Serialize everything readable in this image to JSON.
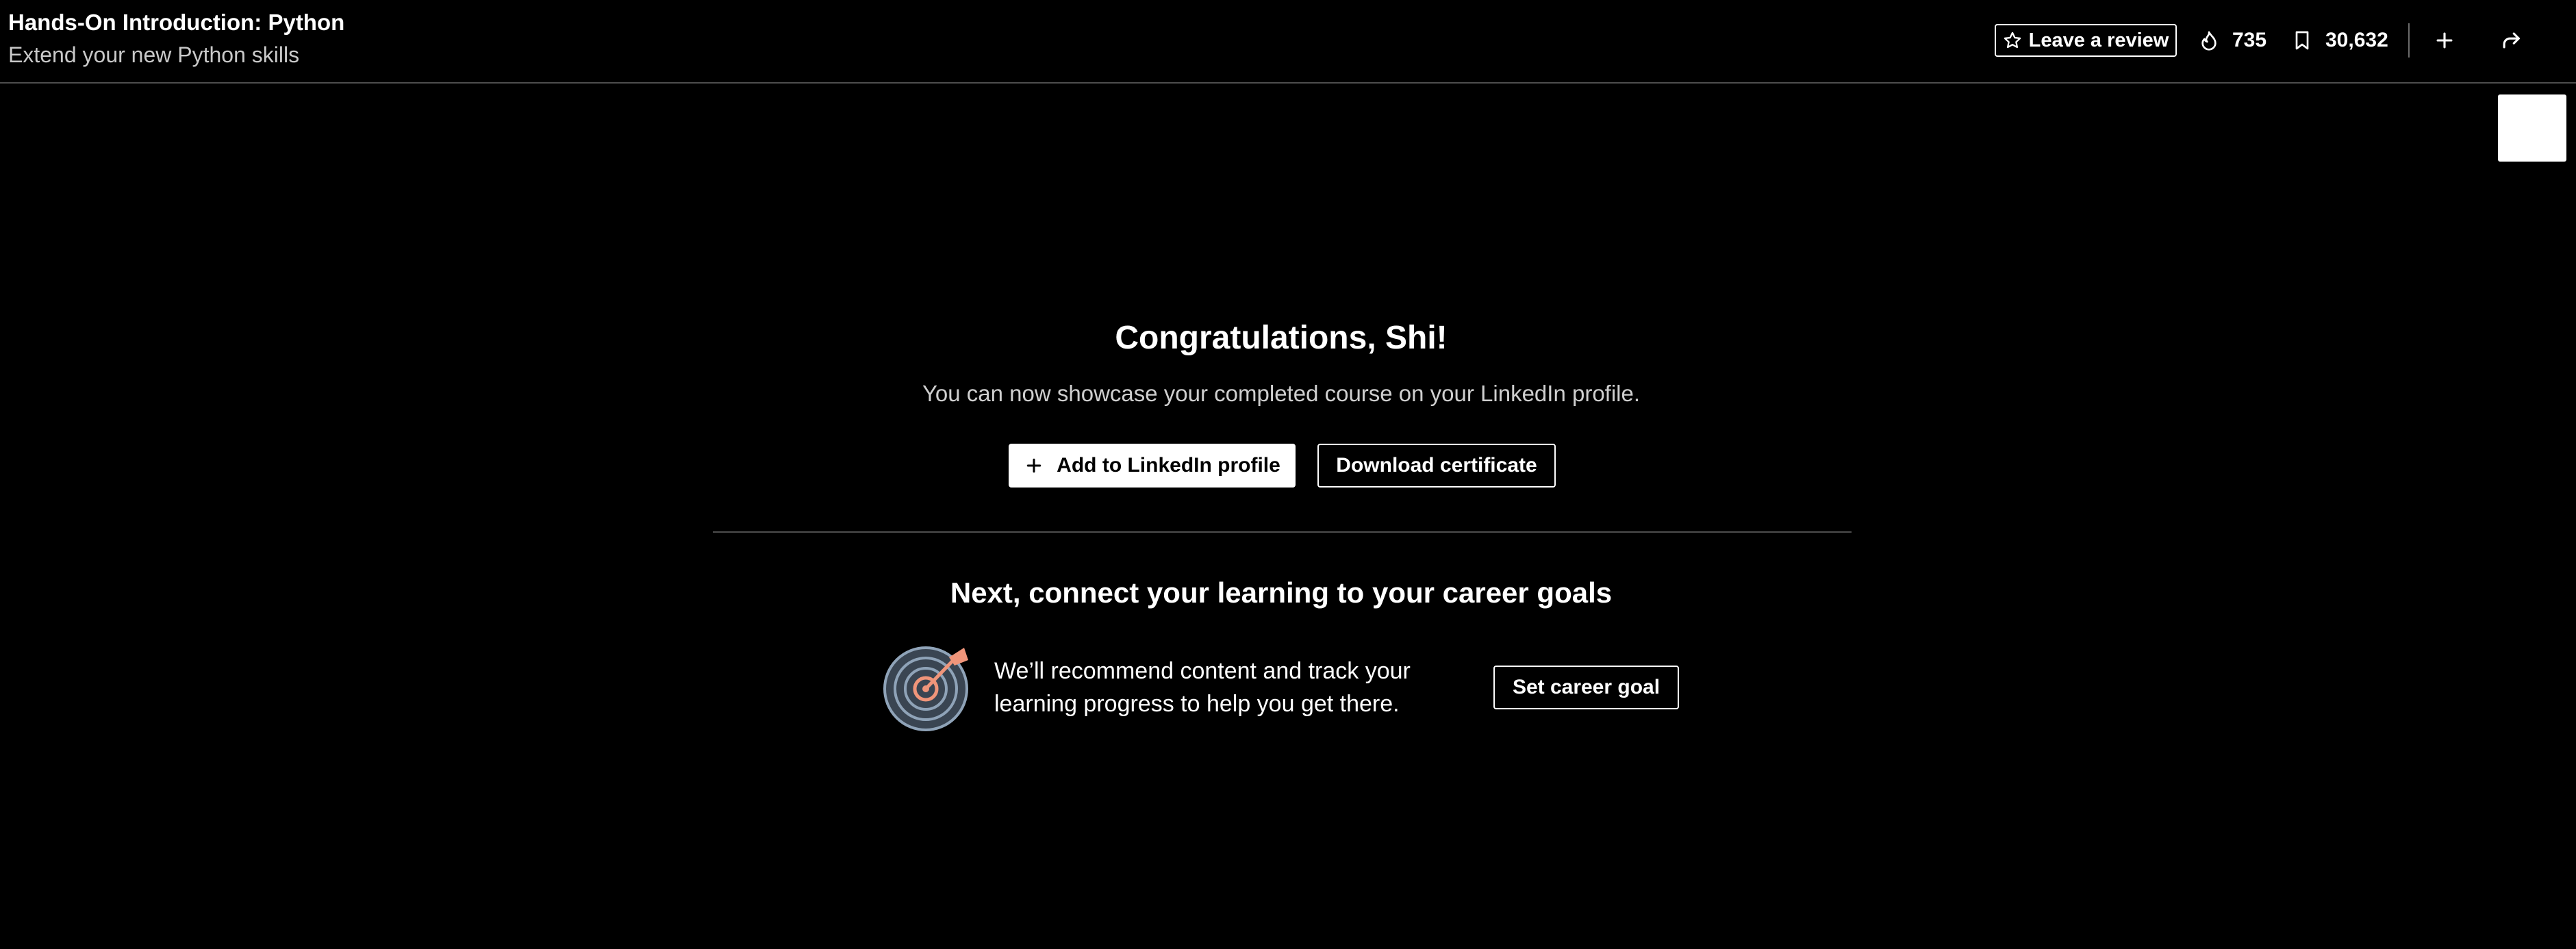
{
  "header": {
    "course_title": "Hands-On Introduction: Python",
    "course_subtitle": "Extend your new Python skills",
    "review_label": "Leave a review",
    "likes_count": "735",
    "saves_count": "30,632",
    "icons": {
      "review": "star-icon",
      "likes": "like-icon",
      "saves": "bookmark-icon",
      "add": "plus-icon",
      "share": "share-icon"
    }
  },
  "completion": {
    "heading": "Congratulations, Shi!",
    "message": "You can now showcase your completed course on your LinkedIn profile.",
    "add_profile_label": "Add to LinkedIn profile",
    "download_label": "Download certificate"
  },
  "career": {
    "heading": "Next, connect your learning to your career goals",
    "text": "We’ll recommend content and track your learning progress to help you get there.",
    "button_label": "Set career goal",
    "icon": "target-icon"
  },
  "colors": {
    "background": "#000000",
    "text": "#ffffff",
    "muted_text": "#cfcfcf",
    "divider": "#4d4d4d",
    "target_ring": "#8fa3b8",
    "target_accent": "#f0957a"
  }
}
